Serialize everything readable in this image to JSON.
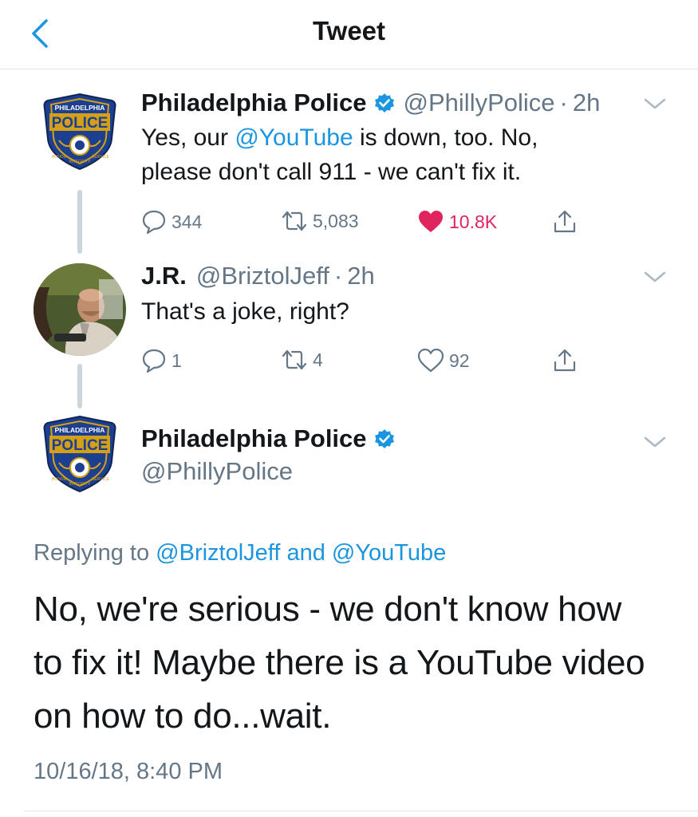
{
  "header": {
    "title": "Tweet"
  },
  "tweet1": {
    "name": "Philadelphia Police",
    "handle": "@PhillyPolice",
    "sep": "·",
    "time": "2h",
    "text_a": "Yes, our ",
    "mention": "@YouTube",
    "text_b": " is down, too. No,",
    "text_c": "please don't call 911 - we can't fix it.",
    "replies": "344",
    "retweets": "5,083",
    "likes": "10.8K"
  },
  "tweet2": {
    "name": "J.R.",
    "handle": "@BriztolJeff",
    "sep": "·",
    "time": "2h",
    "text": "That's a joke, right?",
    "replies": "1",
    "retweets": "4",
    "likes": "92"
  },
  "main": {
    "name": "Philadelphia Police",
    "handle": "@PhillyPolice",
    "replying_prefix": "Replying to",
    "replying_user": "@BriztolJeff",
    "replying_and": "and",
    "replying_user2": "@YouTube",
    "line1": "No, we're serious - we don't know how",
    "line2": "to fix it! Maybe there is a YouTube video",
    "line3": "on how to do...wait.",
    "timestamp": "10/16/18, 8:40 PM"
  },
  "badge": {
    "top": "PHILADELPHIA",
    "middle": "POLICE",
    "left": "HONOR",
    "right": "SERVICE",
    "bottom": "INTEGRITY"
  },
  "colors": {
    "accent": "#1b95e0",
    "like": "#e0245e",
    "muted": "#657786",
    "badge_blue": "#1d3f8f",
    "badge_gold": "#d4a017"
  },
  "icons": [
    "back-chevron-icon",
    "verified-badge-icon",
    "chevron-down-icon",
    "reply-icon",
    "retweet-icon",
    "heart-icon",
    "share-icon"
  ]
}
